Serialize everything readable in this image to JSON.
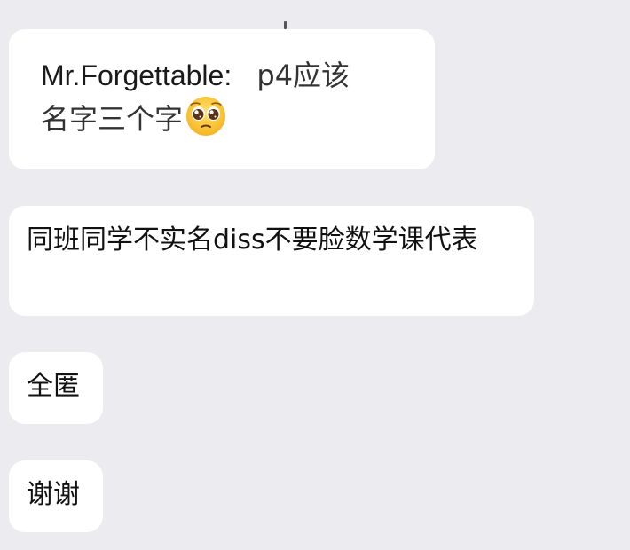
{
  "messages": [
    {
      "type": "quote",
      "author": "Mr.Forgettable:",
      "line1_text": "p4应该",
      "line2_text": "名字三个字",
      "emoji": "pleading-face-icon"
    },
    {
      "type": "text",
      "text": "同班同学不实名diss不要脸数学课代表"
    },
    {
      "type": "text",
      "text": "全匿"
    },
    {
      "type": "text",
      "text": "谢谢"
    }
  ]
}
